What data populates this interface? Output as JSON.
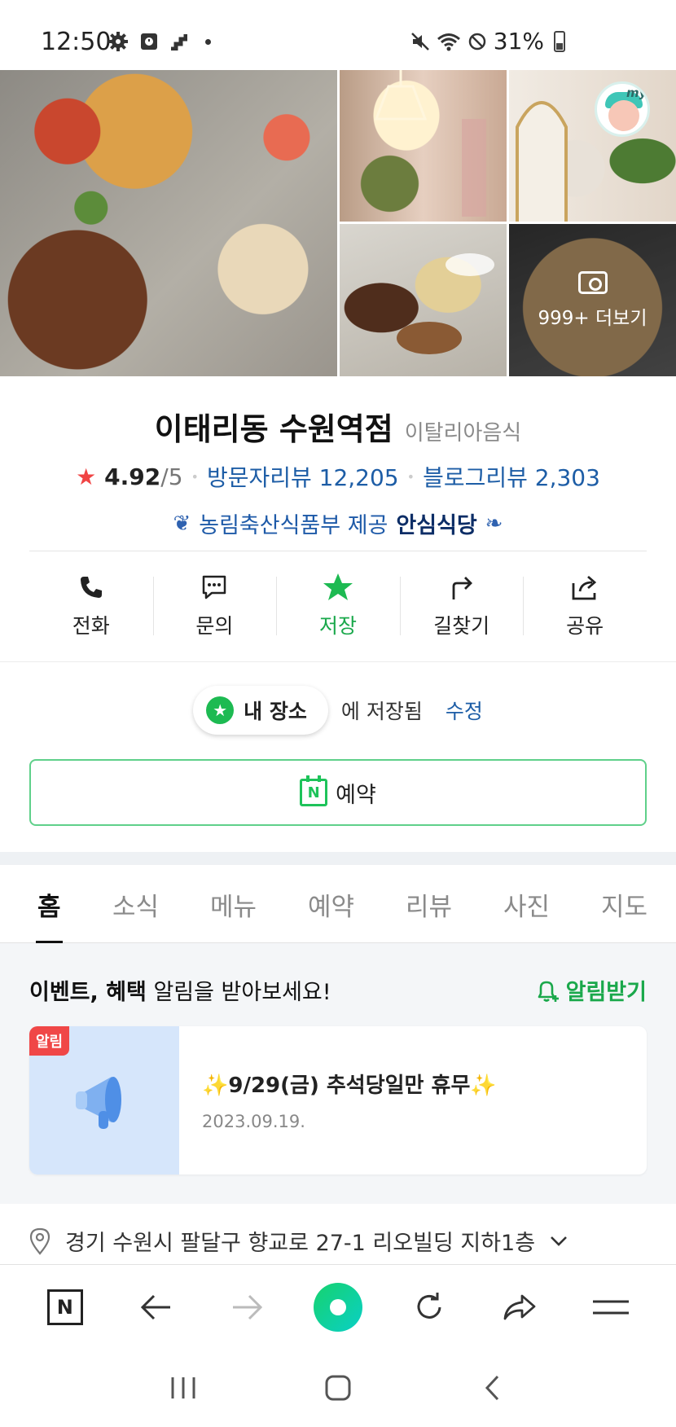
{
  "status_bar": {
    "time": "12:50",
    "battery": "31%",
    "left_icons": [
      "gear-icon",
      "alarm-icon",
      "signal-steps-icon",
      "dot-icon"
    ],
    "right_icons": [
      "mute-icon",
      "wifi-icon",
      "blocked-icon",
      "battery-icon"
    ]
  },
  "photos": {
    "more_label": "999+ 더보기",
    "avatar_text": "my"
  },
  "place": {
    "name": "이태리동 수원역점",
    "category": "이탈리아음식",
    "rating": "4.92",
    "rating_max": "/5",
    "visitor_reviews": "방문자리뷰 12,205",
    "blog_reviews": "블로그리뷰 2,303",
    "cert_text": "농림축산식품부 제공",
    "cert_badge": "안심식당"
  },
  "actions": [
    {
      "label": "전화",
      "icon": "phone-icon"
    },
    {
      "label": "문의",
      "icon": "chat-icon"
    },
    {
      "label": "저장",
      "icon": "star-icon"
    },
    {
      "label": "길찾기",
      "icon": "directions-icon"
    },
    {
      "label": "공유",
      "icon": "share-icon"
    }
  ],
  "saved": {
    "pill_label": "내 장소",
    "saved_text": "에 저장됨",
    "edit_label": "수정"
  },
  "reserve": {
    "label": "예약",
    "icon_letter": "N"
  },
  "tabs": [
    "홈",
    "소식",
    "메뉴",
    "예약",
    "리뷰",
    "사진",
    "지도"
  ],
  "event": {
    "head_bold": "이벤트, 혜택",
    "head_rest": " 알림을 받아보세요!",
    "alarm_label": "알림받기",
    "badge": "알림",
    "title": "✨9/29(금) 추석당일만 휴무✨",
    "date": "2023.09.19."
  },
  "address": {
    "text": "경기 수원시 팔달구 향교로 27-1 리오빌딩 지하1층"
  },
  "browser": {
    "n_letter": "N"
  },
  "colors": {
    "green": "#1aa84b",
    "link_blue": "#1d5da6",
    "star_red": "#f04444"
  }
}
